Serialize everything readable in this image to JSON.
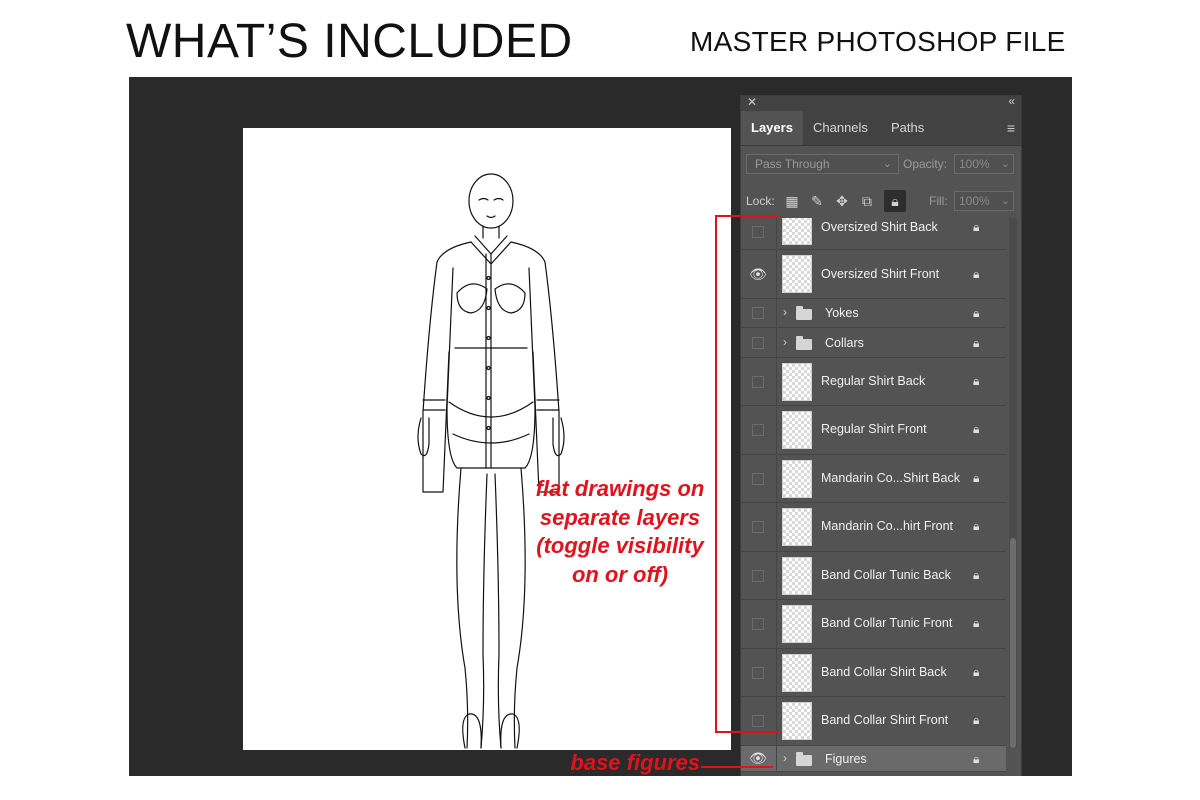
{
  "header": {
    "title": "WHAT’S INCLUDED",
    "subtitle": "MASTER PHOTOSHOP FILE"
  },
  "panel": {
    "tabs": [
      {
        "label": "Layers",
        "active": true
      },
      {
        "label": "Channels",
        "active": false
      },
      {
        "label": "Paths",
        "active": false
      }
    ],
    "blend_mode": "Pass Through",
    "opacity_label": "Opacity:",
    "opacity_value": "100%",
    "lock_label": "Lock:",
    "fill_label": "Fill:",
    "fill_value": "100%",
    "layers": [
      {
        "name": "Oversized Shirt Back",
        "visible": false,
        "type": "layer"
      },
      {
        "name": "Oversized Shirt Front",
        "visible": true,
        "type": "layer"
      },
      {
        "name": "Yokes",
        "visible": false,
        "type": "group"
      },
      {
        "name": "Collars",
        "visible": false,
        "type": "group"
      },
      {
        "name": "Regular Shirt Back",
        "visible": false,
        "type": "layer"
      },
      {
        "name": "Regular Shirt Front",
        "visible": false,
        "type": "layer"
      },
      {
        "name": "Mandarin Co...Shirt Back",
        "visible": false,
        "type": "layer"
      },
      {
        "name": "Mandarin Co...hirt Front",
        "visible": false,
        "type": "layer"
      },
      {
        "name": "Band Collar Tunic Back",
        "visible": false,
        "type": "layer"
      },
      {
        "name": "Band Collar Tunic Front",
        "visible": false,
        "type": "layer"
      },
      {
        "name": "Band Collar Shirt Back",
        "visible": false,
        "type": "layer"
      },
      {
        "name": "Band Collar Shirt Front",
        "visible": false,
        "type": "layer"
      },
      {
        "name": "Figures",
        "visible": true,
        "type": "group"
      }
    ]
  },
  "annotations": {
    "flat_lines": [
      "flat drawings on",
      "separate layers",
      "(toggle visibility",
      "on or off)"
    ],
    "base": "base figures"
  },
  "colors": {
    "annotation": "#e0121c",
    "workspace": "#2a2a2a",
    "panel": "#535353"
  }
}
